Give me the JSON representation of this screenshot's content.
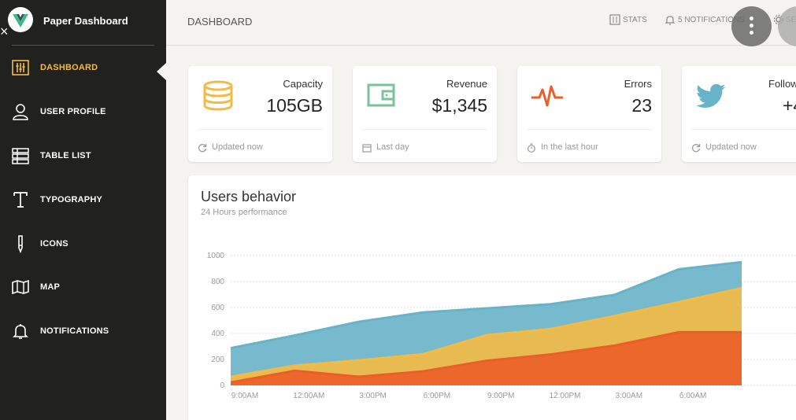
{
  "brand": {
    "title": "Paper Dashboard",
    "close_glyph": "×"
  },
  "sidebar": {
    "items": [
      {
        "label": "DASHBOARD",
        "icon": "panel-settings-icon",
        "active": true
      },
      {
        "label": "USER PROFILE",
        "icon": "user-icon"
      },
      {
        "label": "TABLE LIST",
        "icon": "table-list-icon"
      },
      {
        "label": "TYPOGRAPHY",
        "icon": "typography-icon"
      },
      {
        "label": "ICONS",
        "icon": "pencil-icon"
      },
      {
        "label": "MAP",
        "icon": "map-icon"
      },
      {
        "label": "NOTIFICATIONS",
        "icon": "bell-icon"
      }
    ]
  },
  "header": {
    "title": "DASHBOARD",
    "links": {
      "stats": "STATS",
      "notifications": "5 NOTIFICATIONS",
      "settings": "SE"
    }
  },
  "cards": [
    {
      "category": "Capacity",
      "value": "105GB",
      "footer": "Updated now",
      "icon": "database-icon",
      "footer_icon": "refresh-icon",
      "color": "#f3bb45"
    },
    {
      "category": "Revenue",
      "value": "$1,345",
      "footer": "Last day",
      "icon": "wallet-icon",
      "footer_icon": "calendar-icon",
      "color": "#7ac29a"
    },
    {
      "category": "Errors",
      "value": "23",
      "footer": "In the last hour",
      "icon": "pulse-icon",
      "footer_icon": "timer-icon",
      "color": "#eb5e28"
    },
    {
      "category": "Follow",
      "value": "+4",
      "footer": "Updated now",
      "icon": "twitter-icon",
      "footer_icon": "refresh-icon",
      "color": "#68b3c8"
    }
  ],
  "users_chart": {
    "title": "Users behavior",
    "subtitle": "24 Hours performance"
  },
  "chart_data": {
    "type": "area",
    "x": [
      "9:00AM",
      "12:00AM",
      "3:00PM",
      "6:00PM",
      "9:00PM",
      "12:00PM",
      "3:00AM",
      "6:00AM"
    ],
    "series": [
      {
        "color": "#68b3c8",
        "values": [
          287,
          385,
          490,
          562,
          594,
          626,
          698,
          895
        ]
      },
      {
        "color": "#f3bb45",
        "values": [
          67,
          152,
          193,
          240,
          387,
          435,
          535,
          642
        ]
      },
      {
        "color": "#eb5e28",
        "values": [
          23,
          113,
          67,
          108,
          190,
          239,
          307,
          410
        ]
      }
    ],
    "last_point": {
      "blue": 950,
      "yellow": 750,
      "orange": 410
    },
    "y_ticks": [
      "0",
      "200",
      "400",
      "600",
      "800",
      "1000"
    ],
    "ylim": [
      0,
      1000
    ],
    "grid": true
  }
}
